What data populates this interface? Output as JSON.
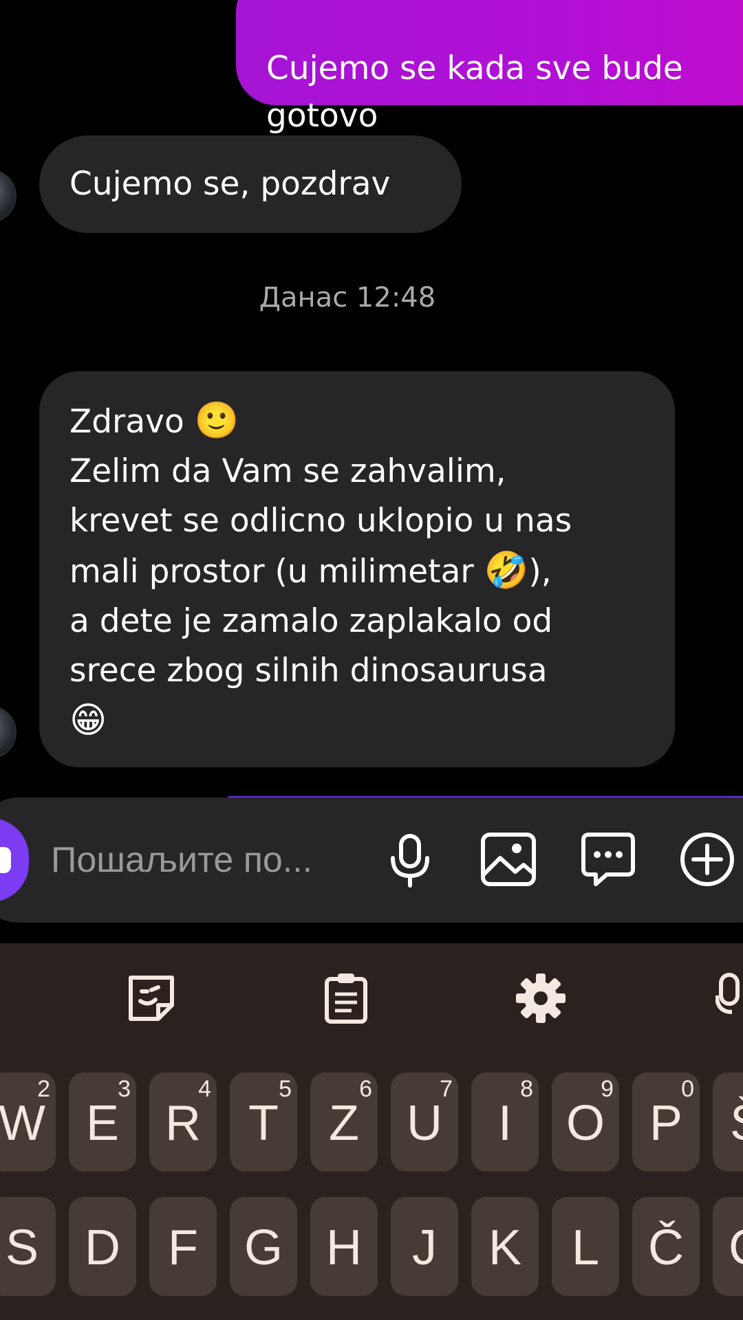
{
  "chat": {
    "outgoing_message": "Cujemo se kada sve bude\ngotovo",
    "incoming_short": "Cujemo se, pozdrav",
    "timestamp": "Данас 12:48",
    "incoming_long_line1": "Zdravo ",
    "incoming_long_emoji1": "🙂",
    "incoming_long_body": "Zelim da Vam se zahvalim,\nkrevet se odlicno uklopio u nas\nmali prostor (u milimetar ",
    "incoming_long_emoji2": "🤣",
    "incoming_long_body2": "),\na dete je zamalo zaplakalo od\nsrece zbog silnih dinosaurusa\n",
    "incoming_long_emoji3": "😁"
  },
  "compose": {
    "placeholder": "Пошаљите по...",
    "icons": [
      "microphone-icon",
      "image-icon",
      "chat-more-icon",
      "add-circle-icon"
    ]
  },
  "keyboard": {
    "toolbar_icons": [
      "sticker-icon",
      "clipboard-icon",
      "settings-gear-icon",
      "microphone-icon"
    ],
    "row1": [
      {
        "key": "W",
        "alt": "2"
      },
      {
        "key": "E",
        "alt": "3"
      },
      {
        "key": "R",
        "alt": "4"
      },
      {
        "key": "T",
        "alt": "5"
      },
      {
        "key": "Z",
        "alt": "6"
      },
      {
        "key": "U",
        "alt": "7"
      },
      {
        "key": "I",
        "alt": "8"
      },
      {
        "key": "O",
        "alt": "9"
      },
      {
        "key": "P",
        "alt": "0"
      },
      {
        "key": "Š",
        "alt": ""
      }
    ],
    "row2": [
      "S",
      "D",
      "F",
      "G",
      "H",
      "J",
      "K",
      "L",
      "Č",
      "Ć"
    ]
  },
  "colors": {
    "outgoing_bubble": "#b20fd6",
    "incoming_bubble": "#262628",
    "accent": "#7c3cf2",
    "keyboard_bg": "#2b211f",
    "key_bg": "#473b36"
  }
}
